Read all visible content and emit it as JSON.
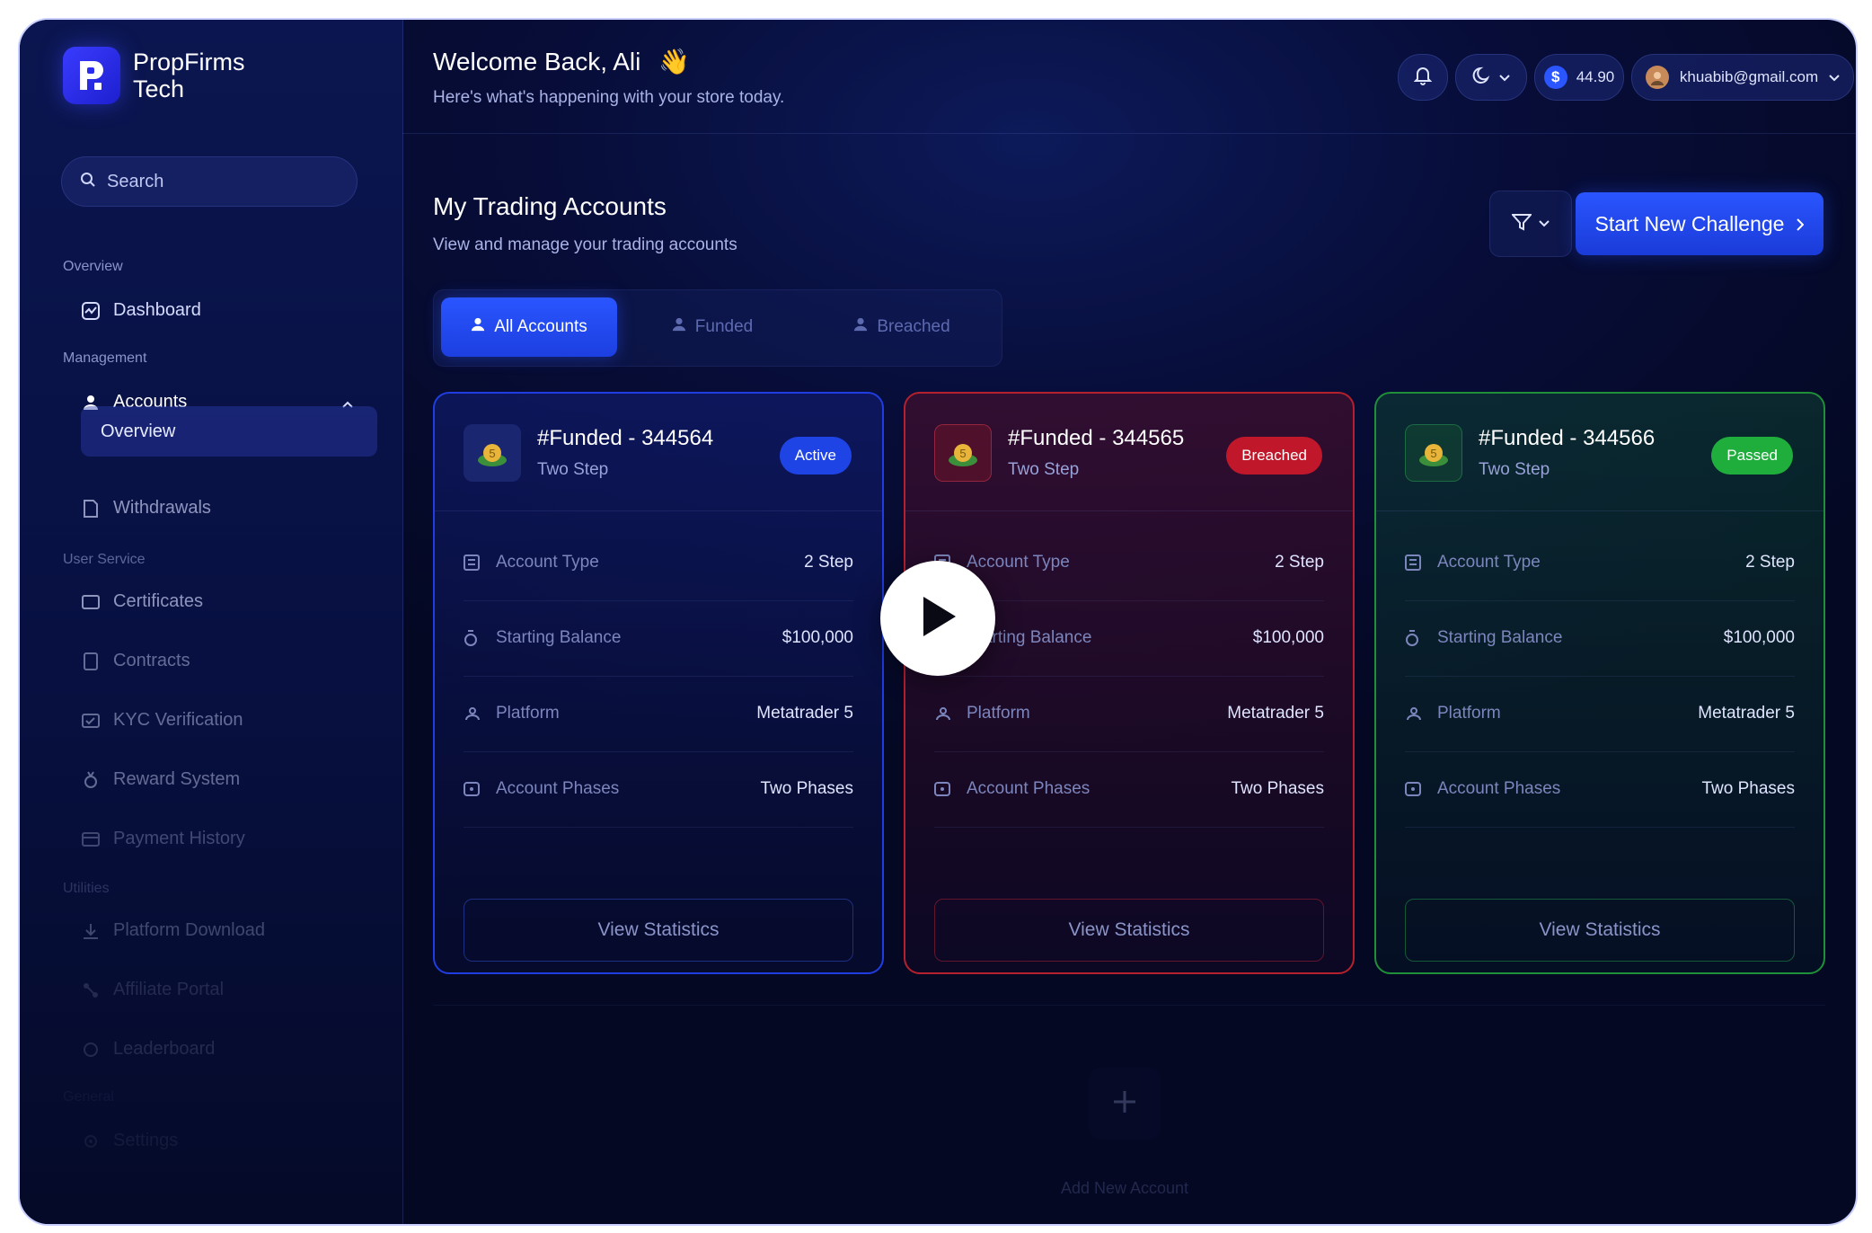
{
  "brand": {
    "name_line1": "PropFirms",
    "name_line2": "Tech"
  },
  "search": {
    "placeholder": "Search"
  },
  "sidebar": {
    "sections": {
      "overview": "Overview",
      "management": "Management",
      "user_service": "User Service",
      "utilities": "Utilities",
      "general": "General"
    },
    "items": {
      "dashboard": "Dashboard",
      "accounts": "Accounts",
      "accounts_overview": "Overview",
      "withdrawals": "Withdrawals",
      "certificates": "Certificates",
      "contracts": "Contracts",
      "kyc": "KYC Verification",
      "reward": "Reward System",
      "payment": "Payment History",
      "platform_download": "Platform Download",
      "affiliate": "Affiliate Portal",
      "leaderboard": "Leaderboard",
      "settings": "Settings"
    }
  },
  "header": {
    "welcome": "Welcome Back, Ali",
    "wave": "👋",
    "subtitle": "Here's what's happening with your store today.",
    "balance": "44.90",
    "currency_symbol": "$",
    "email": "khuabib@gmail.com"
  },
  "main": {
    "title": "My Trading Accounts",
    "subtitle": "View and manage your trading accounts",
    "cta": "Start New Challenge",
    "tabs": [
      "All Accounts",
      "Funded",
      "Breached"
    ]
  },
  "card_labels": {
    "account_type": "Account Type",
    "starting_balance": "Starting Balance",
    "platform": "Platform",
    "account_phases": "Account Phases",
    "view_button": "View Statistics"
  },
  "cards": [
    {
      "title": "#Funded - 344564",
      "sub": "Two Step",
      "status": "Active",
      "color": "#1f44e6",
      "account_type": "2 Step",
      "starting_balance": "$100,000",
      "platform": "Metatrader 5",
      "account_phases": "Two Phases"
    },
    {
      "title": "#Funded - 344565",
      "sub": "Two Step",
      "status": "Breached",
      "color": "#c0182a",
      "account_type": "2 Step",
      "starting_balance": "$100,000",
      "platform": "Metatrader 5",
      "account_phases": "Two Phases"
    },
    {
      "title": "#Funded - 344566",
      "sub": "Two Step",
      "status": "Passed",
      "color": "#1fae3c",
      "account_type": "2 Step",
      "starting_balance": "$100,000",
      "platform": "Metatrader 5",
      "account_phases": "Two Phases"
    }
  ],
  "add_area": {
    "label": "Add New Account"
  },
  "overlay": {
    "icon": "play-icon"
  }
}
